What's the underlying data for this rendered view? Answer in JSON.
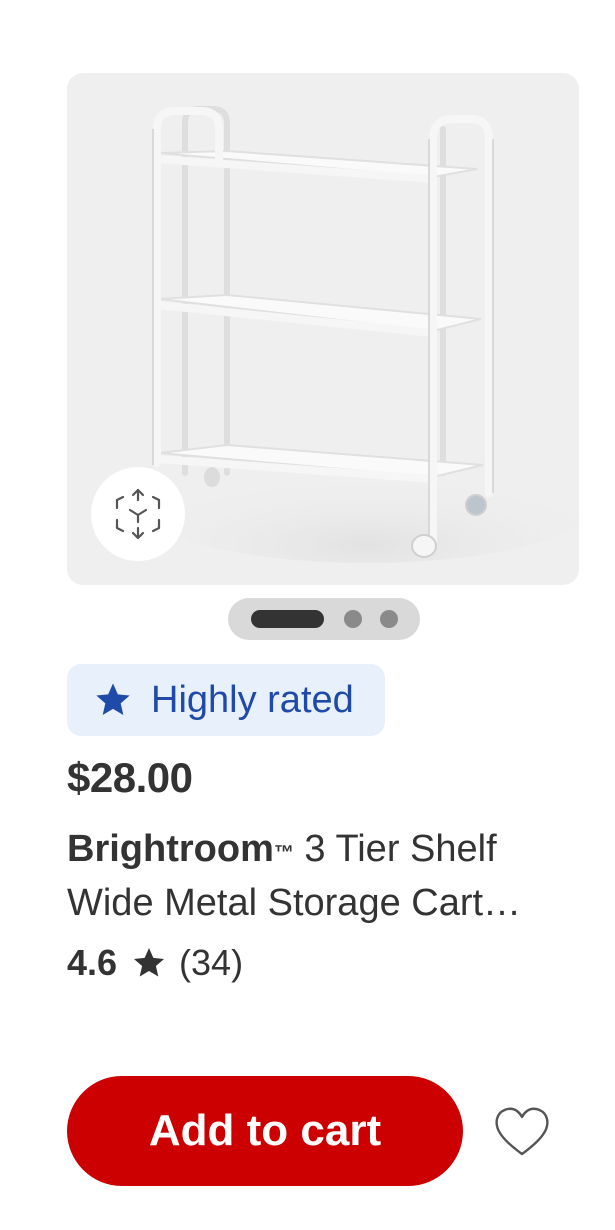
{
  "product": {
    "image_alt": "3 tier white metal storage cart",
    "carousel": {
      "total": 3,
      "active_index": 0
    },
    "badge": {
      "icon": "star-icon",
      "label": "Highly rated",
      "color": "#1f4aa8",
      "background": "#e8f0fb"
    },
    "price": "$28.00",
    "title": {
      "brand": "Brightroom",
      "trademark": "™",
      "line1_rest": " 3 Tier Shelf",
      "line2": "Wide Metal Storage Cart…"
    },
    "rating": {
      "value": "4.6",
      "icon": "star-icon",
      "count": "(34)"
    },
    "actions": {
      "add_to_cart": "Add to cart",
      "add_to_cart_color": "#cc0000",
      "favorite_icon": "heart-outline-icon"
    }
  }
}
